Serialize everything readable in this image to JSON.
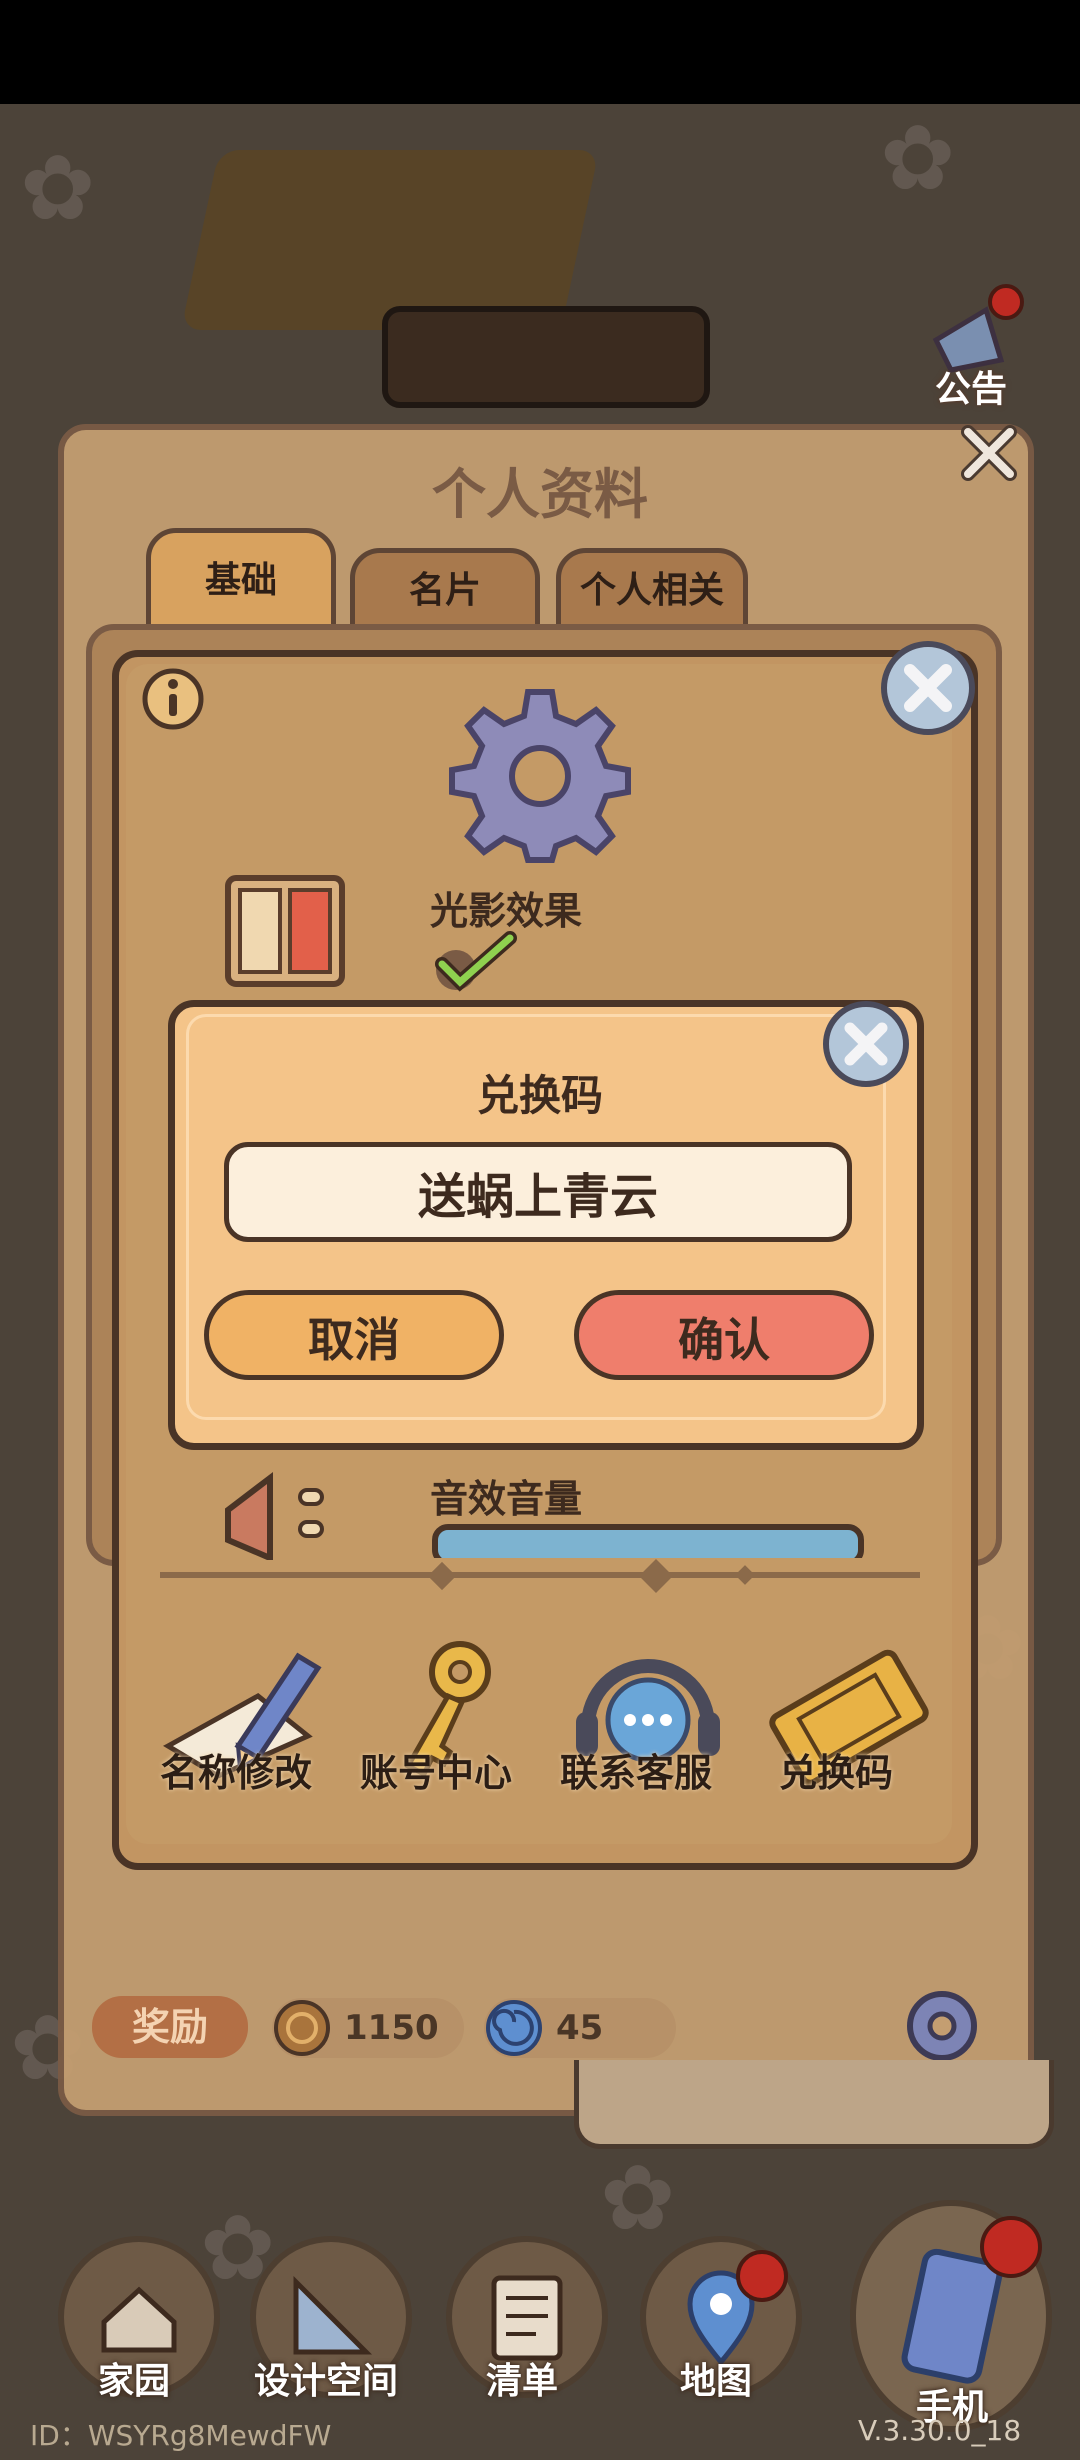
{
  "profile": {
    "title": "个人资料",
    "tabs": [
      {
        "label": "基础"
      },
      {
        "label": "名片"
      },
      {
        "label": "个人相关"
      }
    ],
    "rewards_label": "奖励",
    "coin_count": "1150",
    "gem_count": "45"
  },
  "hud": {
    "notice_label": "公告"
  },
  "settings": {
    "light_effect_label": "光影效果",
    "light_effect_enabled": true,
    "sound_volume_label": "音效音量",
    "features": [
      {
        "label": "名称修改",
        "icon": "pencil-icon"
      },
      {
        "label": "账号中心",
        "icon": "key-icon"
      },
      {
        "label": "联系客服",
        "icon": "headset-icon"
      },
      {
        "label": "兑换码",
        "icon": "ticket-icon"
      }
    ]
  },
  "redeem": {
    "title": "兑换码",
    "input_value": "送蜗上青云",
    "cancel_label": "取消",
    "confirm_label": "确认"
  },
  "bottom_nav": [
    {
      "label": "家园",
      "icon": "home-icon"
    },
    {
      "label": "设计空间",
      "icon": "ruler-icon"
    },
    {
      "label": "清单",
      "icon": "list-icon"
    },
    {
      "label": "地图",
      "icon": "map-pin-icon"
    },
    {
      "label": "手机",
      "icon": "phone-icon"
    }
  ],
  "footer": {
    "uid": "ID：WSYRg8MewdFW",
    "version": "V.3.30.0_18"
  },
  "colors": {
    "panel": "#c49e71",
    "dialog": "#f4c489",
    "cancel": "#f0b265",
    "confirm": "#ef7e6c",
    "outline": "#4a3426"
  }
}
